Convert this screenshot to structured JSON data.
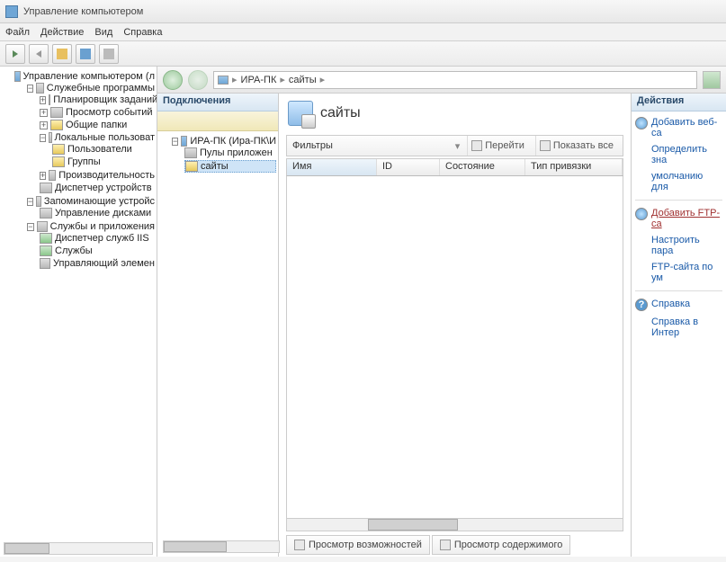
{
  "window": {
    "title": "Управление компьютером"
  },
  "menu": {
    "file": "Файл",
    "action": "Действие",
    "view": "Вид",
    "help": "Справка"
  },
  "tree": {
    "root": "Управление компьютером (л",
    "sys_tools": "Служебные программы",
    "task_sched": "Планировщик заданий",
    "event_viewer": "Просмотр событий",
    "shared": "Общие папки",
    "local_users": "Локальные пользоват",
    "users": "Пользователи",
    "groups": "Группы",
    "perf": "Производительность",
    "devmgr": "Диспетчер устройств",
    "storage": "Запоминающие устройс",
    "diskmgmt": "Управление дисками",
    "services_apps": "Службы и приложения",
    "iis": "Диспетчер служб IIS",
    "services": "Службы",
    "wmi": "Управляющий элемен"
  },
  "breadcrumb": {
    "host": "ИРА-ПК",
    "node": "сайты"
  },
  "connections": {
    "header": "Подключения",
    "host": "ИРА-ПК (Ира-ПК\\И",
    "apppools": "Пулы приложен",
    "sites": "сайты"
  },
  "center": {
    "title": "сайты",
    "filter_label": "Фильтры",
    "go": "Перейти",
    "showall": "Показать все",
    "col_name": "Имя",
    "col_id": "ID",
    "col_state": "Состояние",
    "col_binding": "Тип привязки",
    "view_features": "Просмотр возможностей",
    "view_content": "Просмотр содержимого"
  },
  "actions": {
    "header": "Действия",
    "add_website": "Добавить веб-са",
    "set_defaults": "Определить зна",
    "set_defaults2": "умолчанию для",
    "add_ftp": "Добавить FTP-са",
    "ftp_params": "Настроить пара",
    "ftp_params2": "FTP-сайта по ум",
    "help": "Справка",
    "online_help": "Справка в Интер"
  }
}
